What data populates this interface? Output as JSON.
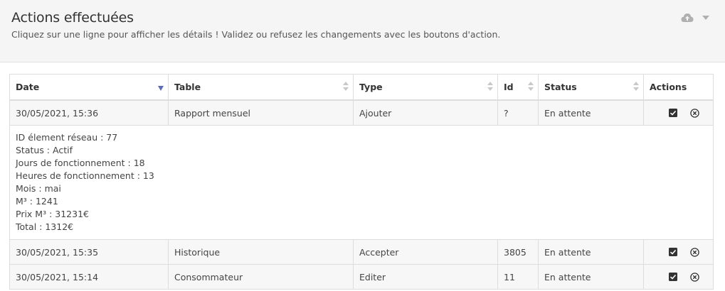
{
  "header": {
    "title": "Actions effectuées",
    "subtitle": "Cliquez sur une ligne pour afficher les détails ! Validez ou refusez les changements avec les boutons d'action."
  },
  "table": {
    "columns": [
      "Date",
      "Table",
      "Type",
      "Id",
      "Status",
      "Actions"
    ],
    "rows": [
      {
        "date": "30/05/2021, 15:36",
        "table": "Rapport mensuel",
        "type": "Ajouter",
        "id": "?",
        "status": "En attente"
      },
      {
        "date": "30/05/2021, 15:35",
        "table": "Historique",
        "type": "Accepter",
        "id": "3805",
        "status": "En attente"
      },
      {
        "date": "30/05/2021, 15:14",
        "table": "Consommateur",
        "type": "Editer",
        "id": "11",
        "status": "En attente"
      }
    ],
    "detail": [
      "ID élement réseau : 77",
      "Status : Actif",
      "Jours de fonctionnement : 18",
      "Heures de fonctionnement : 13",
      "Mois : mai",
      "M³ : 1241",
      "Prix M³ : 31231€",
      "Total : 1312€"
    ]
  },
  "icons": {
    "upload": "cloud-upload-icon",
    "dropdown": "caret-down-icon",
    "validate": "checkbox-checked-icon",
    "refuse": "circle-x-icon"
  },
  "colors": {
    "sort_active": "#5b6cb5",
    "icon": "#333333"
  }
}
